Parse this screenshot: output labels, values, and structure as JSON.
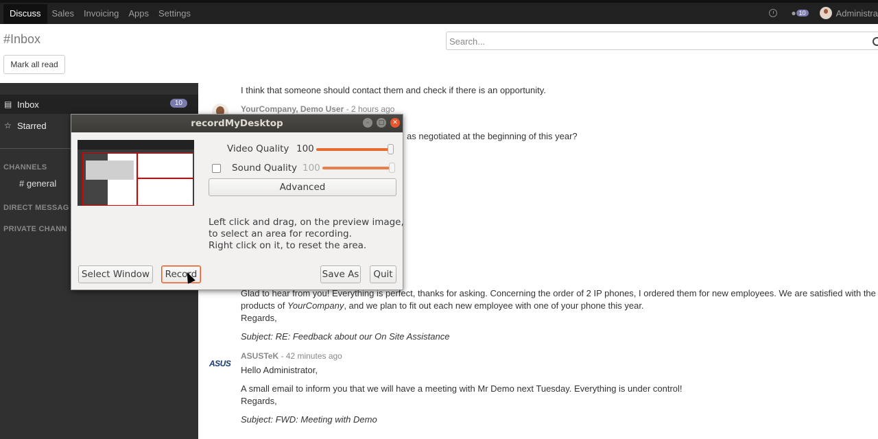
{
  "topbar": {
    "menu": [
      "Discuss",
      "Sales",
      "Invoicing",
      "Apps",
      "Settings"
    ],
    "active_menu": "Discuss",
    "messages_count": "10",
    "user": "Administra"
  },
  "control": {
    "title": "#Inbox",
    "mark_all_read": "Mark all read",
    "search_placeholder": "Search..."
  },
  "sidebar": {
    "inbox_label": "Inbox",
    "inbox_count": "10",
    "starred_label": "Starred",
    "channels_header": "CHANNELS",
    "channel_general": "# general",
    "direct_header": "DIRECT MESSAG",
    "private_header": "PRIVATE CHANN"
  },
  "thread": {
    "line1": "I think that someone should contact them and check if there is an opportunity.",
    "author1": "YourCompany, Demo User",
    "time1": " - 2 hours ago",
    "fragment1": "as negotiated at the beginning of this year?",
    "line2a": "Glad to hear from you! Everything is perfect, thanks for asking. Concerning the order of 2 IP phones, I ordered them for new employees. We are satisfied with the",
    "line2b_pre": "products of ",
    "line2b_em": "YourCompany",
    "line2b_post": ", and we plan to fit out each new employee with one of your phone this year.",
    "line2c": "Regards,",
    "subject2": "Subject: RE: Feedback about our On Site Assistance",
    "asus_logo": "ASUS",
    "author3": "ASUSTeK",
    "time3": " - 42 minutes ago",
    "line3a": "Hello Administrator,",
    "line3b": "A small email to inform you that we will have a meeting with Mr Demo next Tuesday. Everything is under control!",
    "line3c": "Regards,",
    "subject3": "Subject: FWD: Meeting with Demo"
  },
  "dialog": {
    "title": "recordMyDesktop",
    "video_label": "Video Quality",
    "video_value": "100",
    "video_level": 1.0,
    "sound_label": "Sound Quality",
    "sound_value": "100",
    "sound_level": 1.0,
    "sound_checked": false,
    "advanced": "Advanced",
    "info1": "Left click and drag, on the preview image,",
    "info2": "to select an area for recording.",
    "info3": "Right click on it, to reset the area.",
    "select_window": "Select Window",
    "record": "Record",
    "save_as": "Save As",
    "quit": "Quit",
    "accent": "#e6562c"
  }
}
